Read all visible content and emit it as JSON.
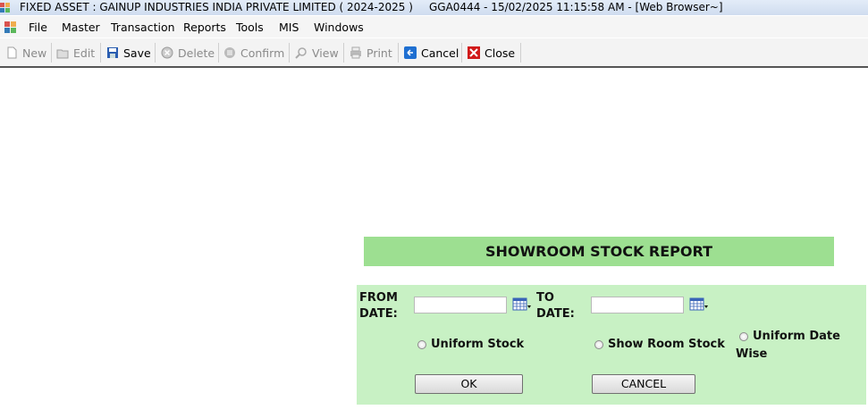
{
  "window": {
    "title": "FIXED ASSET : GAINUP INDUSTRIES INDIA PRIVATE LIMITED ( 2024-2025 )",
    "session": "GGA0444 - 15/02/2025 11:15:58 AM - [Web Browser~]"
  },
  "menu": {
    "items": [
      "File",
      "Master",
      "Transaction",
      "Reports",
      "Tools",
      "MIS",
      "Windows"
    ]
  },
  "toolbar": {
    "new": "New",
    "edit": "Edit",
    "save": "Save",
    "delete": "Delete",
    "confirm": "Confirm",
    "view": "View",
    "print": "Print",
    "cancel": "Cancel",
    "close": "Close"
  },
  "report": {
    "title": "SHOWROOM STOCK REPORT",
    "from_label_1": "FROM",
    "from_label_2": "DATE:",
    "to_label_1": "TO",
    "to_label_2": "DATE:",
    "from_value": "",
    "to_value": "",
    "radio_uniform_stock": "Uniform Stock",
    "radio_show_room_stock": "Show Room Stock",
    "radio_uniform_date_1": "Uniform Date",
    "radio_uniform_date_2": "Wise",
    "ok": "OK",
    "cancel": "CANCEL"
  },
  "colors": {
    "title_band": "#9ddf91",
    "panel_bg": "#c8f1c4"
  }
}
